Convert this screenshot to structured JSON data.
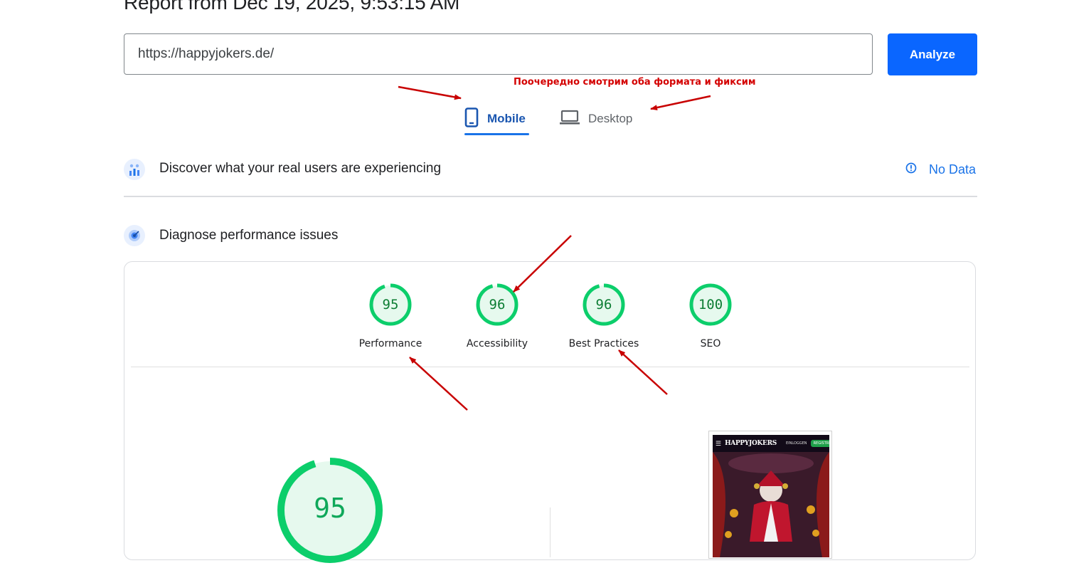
{
  "report": {
    "title": "Report from Dec 19, 2025, 9:53:15 AM"
  },
  "url_input": {
    "value": "https://happyjokers.de/"
  },
  "analyze": {
    "label": "Analyze"
  },
  "tabs": [
    {
      "label": "Mobile",
      "selected": true,
      "icon": "phone-icon"
    },
    {
      "label": "Desktop",
      "selected": false,
      "icon": "laptop-icon"
    }
  ],
  "annotation": {
    "note": "Поочередно смотрим оба формата и фиксим"
  },
  "crux": {
    "title": "Discover what your real users are experiencing",
    "status": "No Data",
    "icon": "users-chart-icon",
    "status_icon": "info-icon"
  },
  "diagnose": {
    "title": "Diagnose performance issues",
    "icon": "gauge-icon"
  },
  "scores": [
    {
      "label": "Performance",
      "value": 95
    },
    {
      "label": "Accessibility",
      "value": 96
    },
    {
      "label": "Best Practices",
      "value": 96
    },
    {
      "label": "SEO",
      "value": 100
    }
  ],
  "main_score": {
    "value": 95
  },
  "screenshot": {
    "logo": "HAPPYJOKERS",
    "login": "EINLOGGEN",
    "register": "REGISTRIEREN"
  },
  "colors": {
    "pass": "#0cce6b",
    "accent": "#1a73e8",
    "button": "#0a66ff",
    "annotation": "#d40000"
  }
}
